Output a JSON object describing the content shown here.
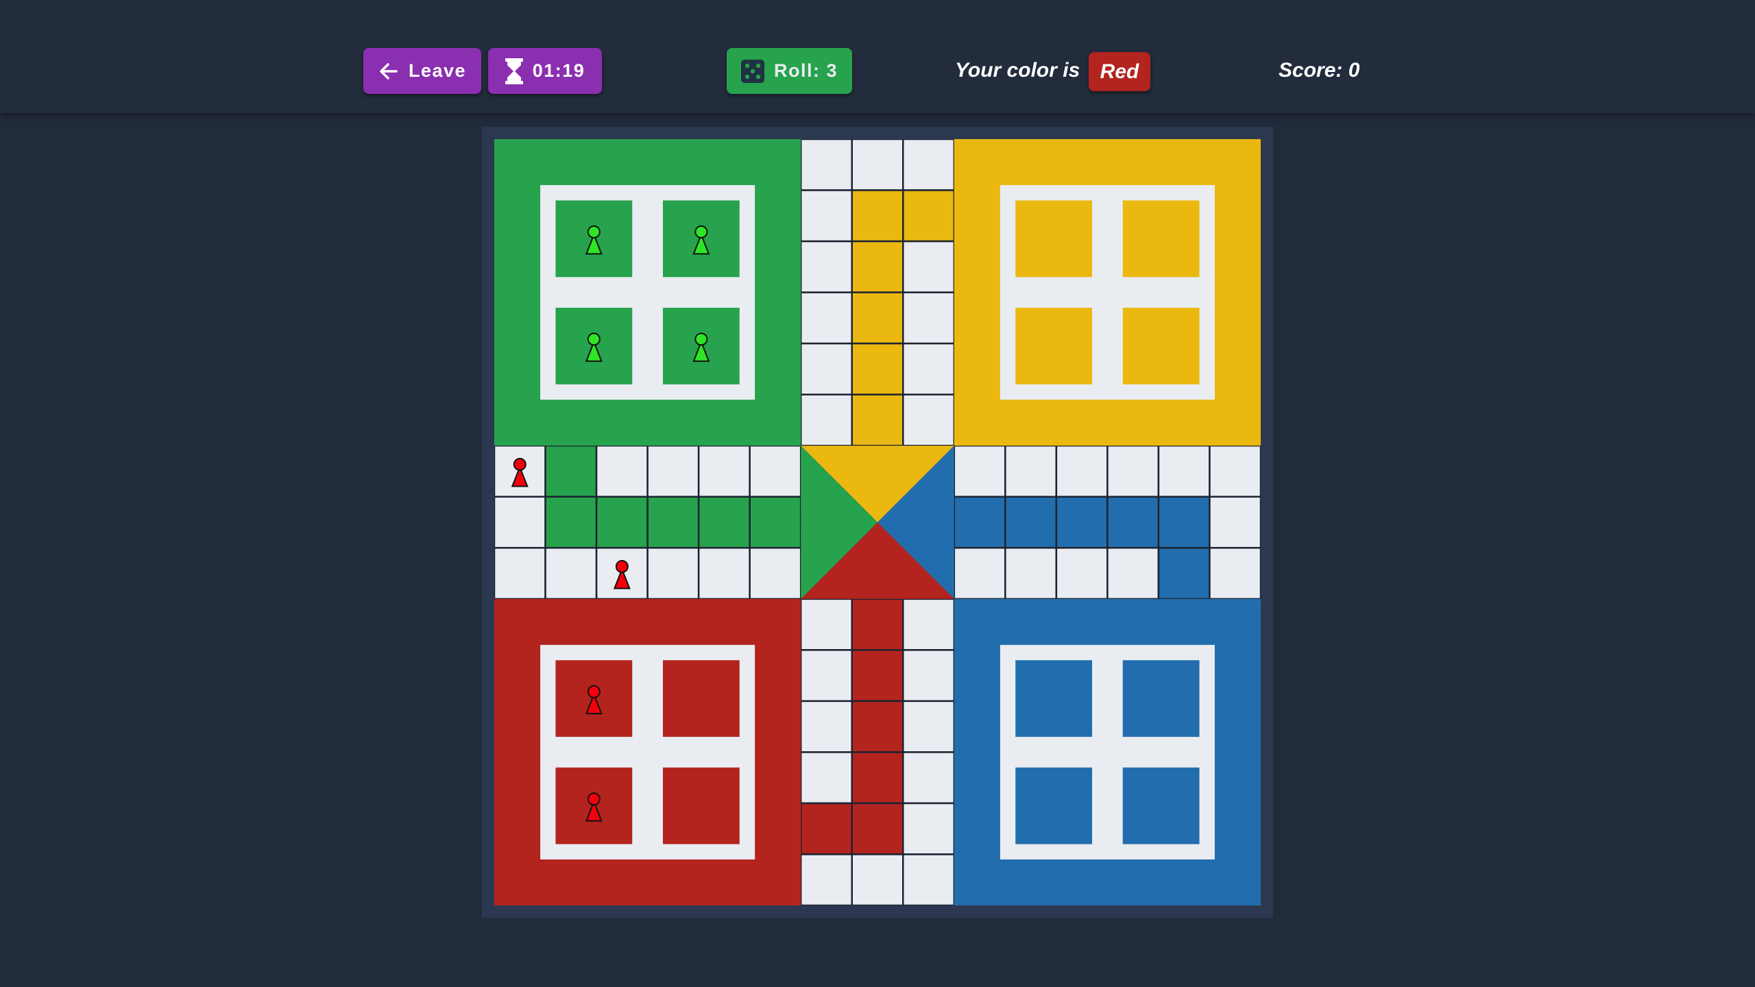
{
  "topbar": {
    "leave_label": "Leave",
    "timer": "01:19",
    "roll_label": "Roll: 3",
    "color_label": "Your color is",
    "player_color": "Red",
    "score_label": "Score: 0"
  },
  "colors": {
    "green": "#27a24d",
    "yellow": "#ebb810",
    "blue": "#226dad",
    "red": "#b3241f",
    "cell": "#e9edf2",
    "purple": "#8a2fb0",
    "green_pawn": "#2ee625",
    "red_pawn": "#f2000a"
  },
  "board": {
    "colored_cells": [
      {
        "row": 1,
        "col": 7,
        "color": "yellow"
      },
      {
        "row": 1,
        "col": 8,
        "color": "yellow"
      },
      {
        "row": 2,
        "col": 7,
        "color": "yellow"
      },
      {
        "row": 3,
        "col": 7,
        "color": "yellow"
      },
      {
        "row": 4,
        "col": 7,
        "color": "yellow"
      },
      {
        "row": 5,
        "col": 7,
        "color": "yellow"
      },
      {
        "row": 6,
        "col": 1,
        "color": "green"
      },
      {
        "row": 7,
        "col": 1,
        "color": "green"
      },
      {
        "row": 7,
        "col": 2,
        "color": "green"
      },
      {
        "row": 7,
        "col": 3,
        "color": "green"
      },
      {
        "row": 7,
        "col": 4,
        "color": "green"
      },
      {
        "row": 7,
        "col": 5,
        "color": "green"
      },
      {
        "row": 7,
        "col": 9,
        "color": "blue"
      },
      {
        "row": 7,
        "col": 10,
        "color": "blue"
      },
      {
        "row": 7,
        "col": 11,
        "color": "blue"
      },
      {
        "row": 7,
        "col": 12,
        "color": "blue"
      },
      {
        "row": 7,
        "col": 13,
        "color": "blue"
      },
      {
        "row": 8,
        "col": 13,
        "color": "blue"
      },
      {
        "row": 9,
        "col": 7,
        "color": "red"
      },
      {
        "row": 10,
        "col": 7,
        "color": "red"
      },
      {
        "row": 11,
        "col": 7,
        "color": "red"
      },
      {
        "row": 12,
        "col": 7,
        "color": "red"
      },
      {
        "row": 13,
        "col": 6,
        "color": "red"
      },
      {
        "row": 13,
        "col": 7,
        "color": "red"
      }
    ],
    "home_pawns": [
      {
        "home": "green",
        "slot": 0,
        "color": "green_pawn"
      },
      {
        "home": "green",
        "slot": 1,
        "color": "green_pawn"
      },
      {
        "home": "green",
        "slot": 2,
        "color": "green_pawn"
      },
      {
        "home": "green",
        "slot": 3,
        "color": "green_pawn"
      },
      {
        "home": "red",
        "slot": 0,
        "color": "red_pawn"
      },
      {
        "home": "red",
        "slot": 2,
        "color": "red_pawn"
      }
    ],
    "track_pawns": [
      {
        "row": 6,
        "col": 0,
        "color": "red_pawn"
      },
      {
        "row": 8,
        "col": 2,
        "color": "red_pawn"
      }
    ]
  }
}
